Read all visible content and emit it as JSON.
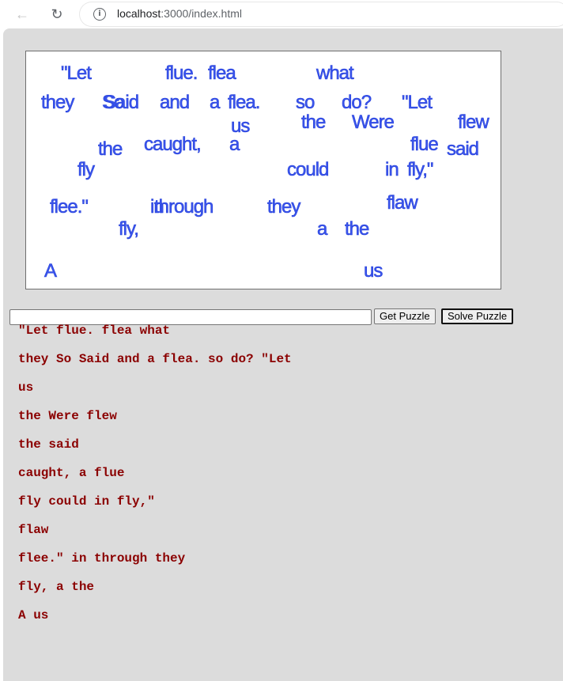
{
  "browser": {
    "url_host": "localhost",
    "url_path": ":3000/index.html"
  },
  "puzzle_words": [
    {
      "text": "\"Let"
    },
    {
      "text": "flue."
    },
    {
      "text": "flea"
    },
    {
      "text": "what"
    },
    {
      "text": "they"
    },
    {
      "text": "So"
    },
    {
      "text": "Said"
    },
    {
      "text": "and"
    },
    {
      "text": "a"
    },
    {
      "text": "flea."
    },
    {
      "text": "so"
    },
    {
      "text": "do?"
    },
    {
      "text": "\"Let"
    },
    {
      "text": "us"
    },
    {
      "text": "the"
    },
    {
      "text": "Were"
    },
    {
      "text": "flew"
    },
    {
      "text": "the"
    },
    {
      "text": "caught,"
    },
    {
      "text": "a"
    },
    {
      "text": "flue"
    },
    {
      "text": "said"
    },
    {
      "text": "fly"
    },
    {
      "text": "could"
    },
    {
      "text": "in"
    },
    {
      "text": "fly,\""
    },
    {
      "text": "flee.\""
    },
    {
      "text": "in"
    },
    {
      "text": "through"
    },
    {
      "text": "they"
    },
    {
      "text": "flaw"
    },
    {
      "text": "fly,"
    },
    {
      "text": "a"
    },
    {
      "text": "the"
    },
    {
      "text": "A"
    },
    {
      "text": "us"
    }
  ],
  "controls": {
    "input_value": "",
    "get_puzzle_label": "Get Puzzle",
    "solve_puzzle_label": "Solve Puzzle"
  },
  "solution_lines": [
    "\"Let flue. flea what",
    "they So Said and a flea. so do? \"Let",
    "us",
    "the Were flew",
    "the said",
    "caught, a flue",
    "fly could in fly,\"",
    "flaw",
    "flee.\" in through they",
    "fly, a the",
    "A us"
  ]
}
